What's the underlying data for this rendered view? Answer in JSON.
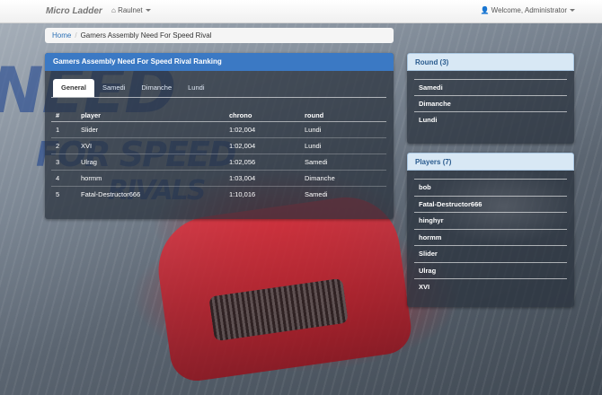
{
  "navbar": {
    "brand": "Micro Ladder",
    "user_menu": "Raulnet",
    "welcome": "Welcome, Administrator"
  },
  "breadcrumb": {
    "home": "Home",
    "current": "Gamers Assembly Need For Speed Rival"
  },
  "ranking": {
    "title": "Gamers Assembly Need For Speed Rival Ranking",
    "tabs": [
      {
        "label": "General",
        "active": true
      },
      {
        "label": "Samedi",
        "active": false
      },
      {
        "label": "Dimanche",
        "active": false
      },
      {
        "label": "Lundi",
        "active": false
      }
    ],
    "columns": [
      "#",
      "player",
      "chrono",
      "round"
    ],
    "rows": [
      {
        "rank": "1",
        "player": "Slider",
        "chrono": "1:02,004",
        "round": "Lundi"
      },
      {
        "rank": "2",
        "player": "XVI",
        "chrono": "1:02,004",
        "round": "Lundi"
      },
      {
        "rank": "3",
        "player": "Ulrag",
        "chrono": "1:02,056",
        "round": "Samedi"
      },
      {
        "rank": "4",
        "player": "hormm",
        "chrono": "1:03,004",
        "round": "Dimanche"
      },
      {
        "rank": "5",
        "player": "Fatal-Destructor666",
        "chrono": "1:10,016",
        "round": "Samedi"
      }
    ]
  },
  "rounds": {
    "title": "Round (3)",
    "items": [
      "Samedi",
      "Dimanche",
      "Lundi"
    ]
  },
  "players": {
    "title": "Players (7)",
    "items": [
      "bob",
      "Fatal-Destructor666",
      "hinghyr",
      "hormm",
      "Slider",
      "Ulrag",
      "XVI"
    ]
  },
  "colors": {
    "panel_heading": "#3b79c4",
    "side_heading": "#d8e8f5",
    "link": "#2a6fb5"
  }
}
